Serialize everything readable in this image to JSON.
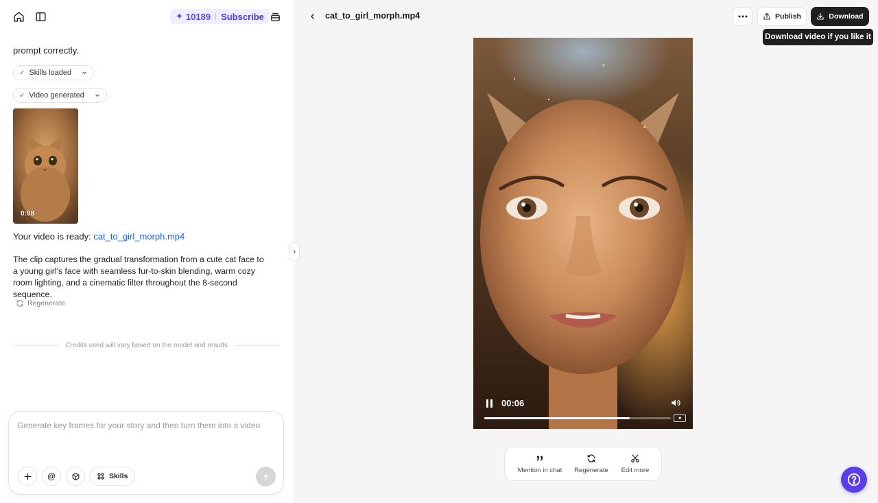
{
  "header": {
    "credits": "10189",
    "subscribe_label": "Subscribe"
  },
  "chat": {
    "prompt_tail": "prompt correctly.",
    "chips": [
      {
        "label": "Skills loaded"
      },
      {
        "label": "Video generated"
      }
    ],
    "thumbnail_duration": "0:08",
    "ready_prefix": "Your video is ready: ",
    "ready_link": "cat_to_girl_morph.mp4",
    "description": "The clip captures the gradual transformation from a cute cat face to a young girl's face with seamless fur-to-skin blending, warm cozy room lighting, and a cinematic filter throughout the 8-second sequence.",
    "regenerate_label": "Regenerate",
    "credits_note": "Credits used will vary based on the model and results"
  },
  "composer": {
    "placeholder": "Generate key frames for your story and then turn them into a video",
    "skills_label": "Skills"
  },
  "viewer": {
    "file_title": "cat_to_girl_morph.mp4",
    "publish_label": "Publish",
    "download_label": "Download",
    "tooltip": "Download video if you like it",
    "current_time": "00:06",
    "progress_fraction": 0.78,
    "actions": [
      {
        "label": "Mention in chat",
        "icon": "quote-icon"
      },
      {
        "label": "Regenerate",
        "icon": "refresh-icon"
      },
      {
        "label": "Edit more",
        "icon": "scissors-icon"
      }
    ]
  },
  "colors": {
    "accent": "#5b3ee8",
    "credits_text": "#5b4bd6",
    "link": "#1a5fd1",
    "dark_button": "#1f1f1f"
  }
}
